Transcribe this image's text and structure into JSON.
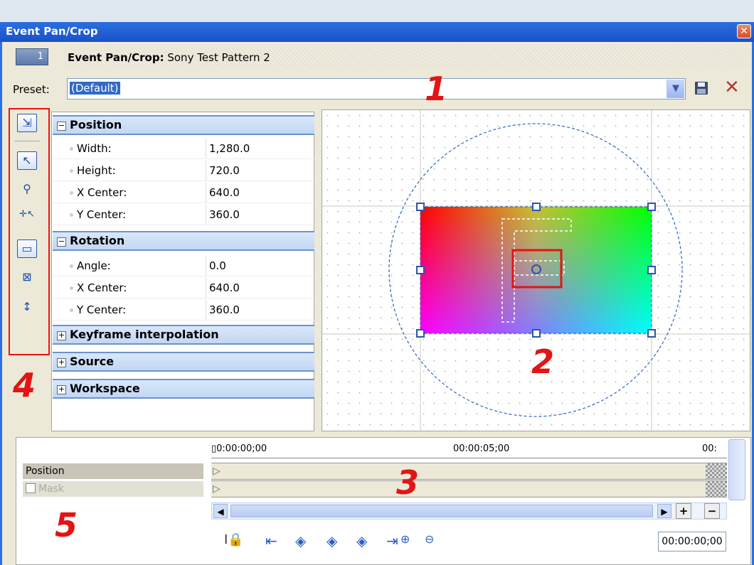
{
  "window": {
    "title": "Event Pan/Crop",
    "close_glyph": "✕"
  },
  "header": {
    "event_number": "1",
    "label_bold": "Event Pan/Crop:",
    "label_rest": " Sony Test Pattern 2"
  },
  "preset": {
    "label": "Preset:",
    "value": "(Default)"
  },
  "sections": {
    "position": {
      "label": "Position",
      "rows": [
        {
          "name": "Width:",
          "value": "1,280.0"
        },
        {
          "name": "Height:",
          "value": "720.0"
        },
        {
          "name": "X Center:",
          "value": "640.0"
        },
        {
          "name": "Y Center:",
          "value": "360.0"
        }
      ]
    },
    "rotation": {
      "label": "Rotation",
      "rows": [
        {
          "name": "Angle:",
          "value": "0.0"
        },
        {
          "name": "X Center:",
          "value": "640.0"
        },
        {
          "name": "Y Center:",
          "value": "360.0"
        }
      ]
    },
    "keyframe": {
      "label": "Keyframe interpolation"
    },
    "source": {
      "label": "Source"
    },
    "workspace": {
      "label": "Workspace"
    }
  },
  "timeline": {
    "ruler": [
      "0:00:00;00",
      "00:00:05;00",
      "00:"
    ],
    "tracks": {
      "position": "Position",
      "mask": "Mask"
    },
    "timecode": "00:00:00;00"
  },
  "annotations": [
    "1",
    "2",
    "3",
    "4",
    "5"
  ]
}
